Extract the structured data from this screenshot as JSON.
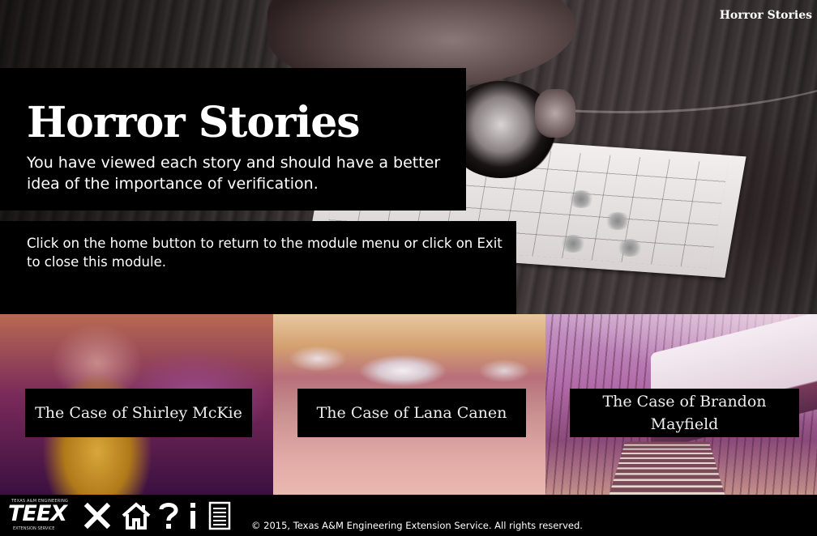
{
  "header": {
    "corner_title": "Horror Stories"
  },
  "hero": {
    "title": "Horror Stories",
    "summary": "You have viewed each story and should have a better idea of the importance of verification.",
    "instructions": "Click on the home button to return to the module menu or click on Exit to close this module."
  },
  "cases": [
    {
      "label": "The Case of Shirley McKie"
    },
    {
      "label": "The Case of Lana Canen"
    },
    {
      "label": "The Case of Brandon Mayfield"
    }
  ],
  "footer": {
    "logo": {
      "top_text": "TEXAS A&M ENGINEERING",
      "main_text": "TEEX",
      "bottom_text": "EXTENSION SERVICE"
    },
    "buttons": [
      {
        "name": "exit",
        "icon": "close-icon"
      },
      {
        "name": "home",
        "icon": "home-icon"
      },
      {
        "name": "help",
        "icon": "question-icon"
      },
      {
        "name": "info",
        "icon": "info-icon"
      },
      {
        "name": "glossary",
        "icon": "document-icon"
      }
    ],
    "copyright": "© 2015, Texas A&M Engineering Extension Service. All rights reserved."
  }
}
